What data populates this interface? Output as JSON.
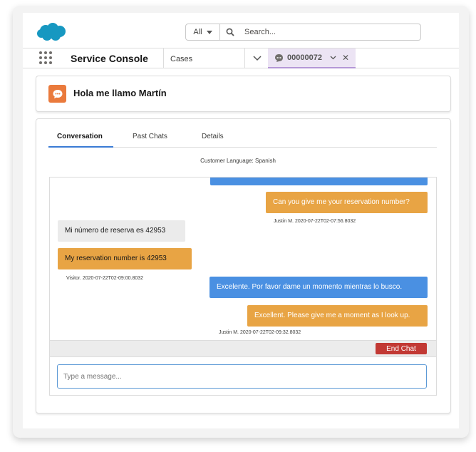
{
  "header": {
    "search_scope": "All",
    "search_placeholder": "Search..."
  },
  "nav": {
    "app_name": "Service Console",
    "object_tab": "Cases",
    "active_tab": "00000072"
  },
  "record": {
    "title": "Hola me llamo Martín"
  },
  "tabs": [
    {
      "label": "Conversation"
    },
    {
      "label": "Past Chats"
    },
    {
      "label": "Details"
    }
  ],
  "customer_language": "Customer Language: Spanish",
  "messages": [
    {
      "text": "Can you give me your reservation number?"
    },
    {
      "text": "Justin M. 2020-07-22T02-07:56.8032"
    },
    {
      "text": "Mi número de reserva es 42953"
    },
    {
      "text": "My reservation number is 42953"
    },
    {
      "text": "Visitor. 2020-07-22T02-09:00.8032"
    },
    {
      "text": "Excelente. Por favor dame un momento mientras lo busco."
    },
    {
      "text": "Excellent. Please give me a moment as I look up."
    },
    {
      "text": "Justin M. 2020-07-22T02-09:32.8032"
    }
  ],
  "end_chat_label": "End Chat",
  "compose_placeholder": "Type a message...",
  "colors": {
    "brand_blue": "#1798c1",
    "agent_bubble_blue": "#4a90e2",
    "translation_orange": "#e8a444",
    "end_chat_red": "#c23934",
    "chat_icon_orange": "#ea7a3c",
    "active_tab_purple": "#ece4f4"
  }
}
